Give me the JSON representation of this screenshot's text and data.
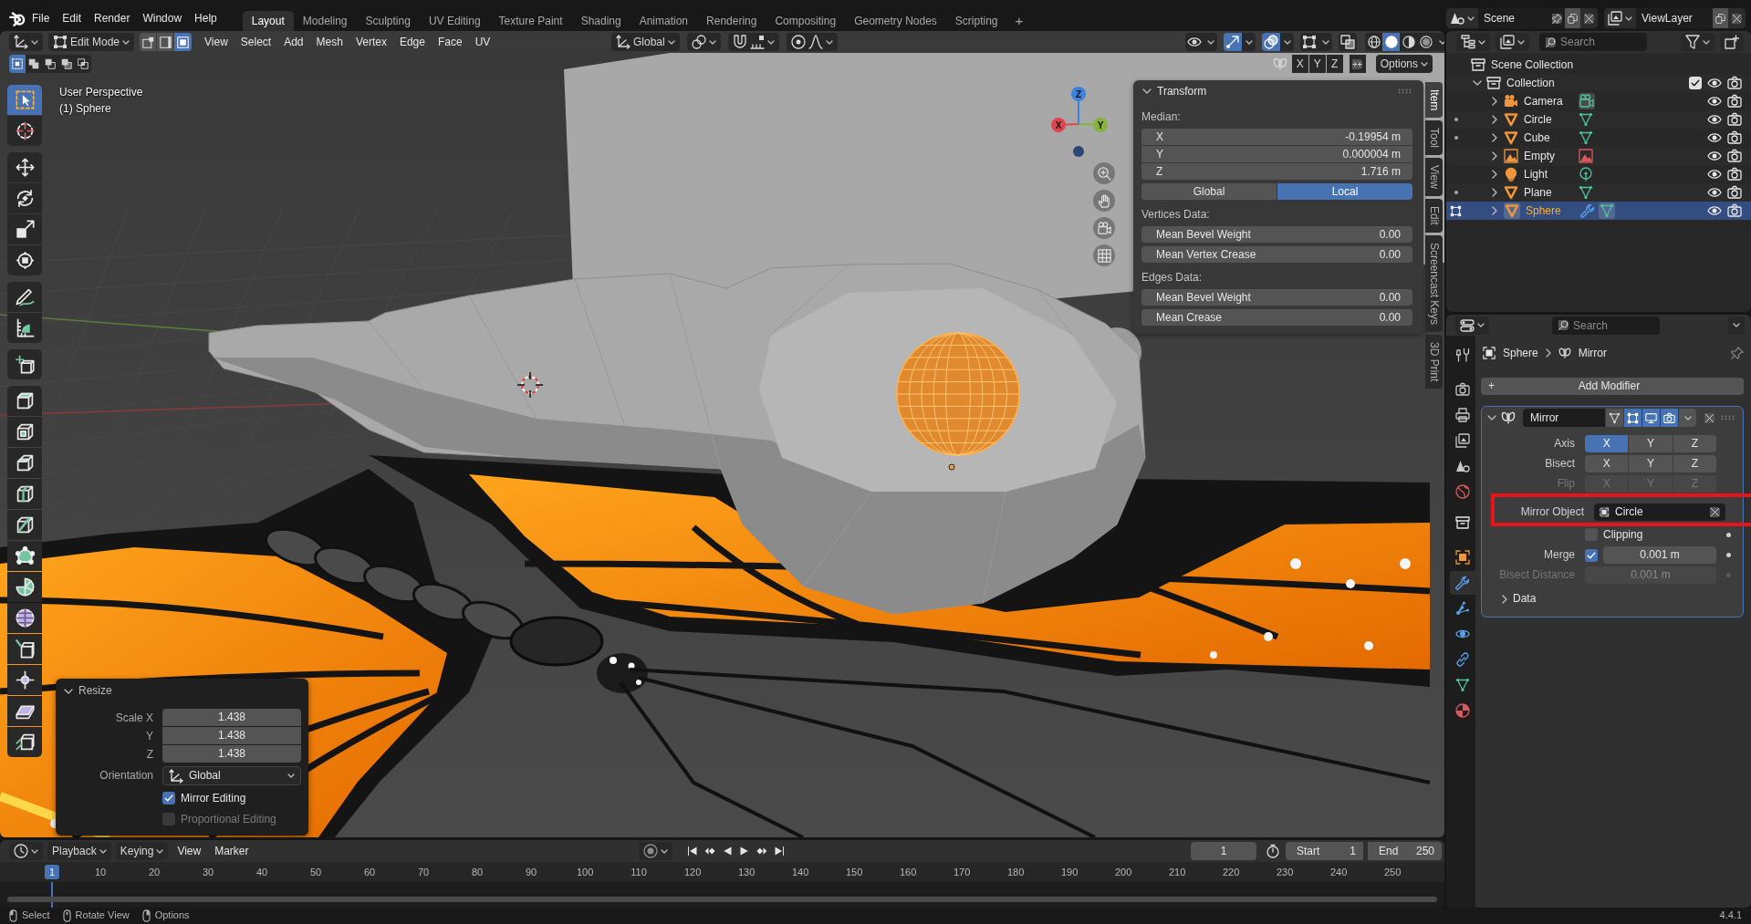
{
  "top_bar": {
    "menus": [
      "File",
      "Edit",
      "Render",
      "Window",
      "Help"
    ],
    "workspaces": [
      {
        "label": "Layout",
        "selected": true
      },
      {
        "label": "Modeling",
        "selected": false
      },
      {
        "label": "Sculpting",
        "selected": false
      },
      {
        "label": "UV Editing",
        "selected": false
      },
      {
        "label": "Texture Paint",
        "selected": false
      },
      {
        "label": "Shading",
        "selected": false
      },
      {
        "label": "Animation",
        "selected": false
      },
      {
        "label": "Rendering",
        "selected": false
      },
      {
        "label": "Compositing",
        "selected": false
      },
      {
        "label": "Geometry Nodes",
        "selected": false
      },
      {
        "label": "Scripting",
        "selected": false
      }
    ],
    "add_workspace": "+",
    "scene": "Scene",
    "view_layer": "ViewLayer"
  },
  "viewport_header": {
    "mode": "Edit Mode",
    "select_modes": [
      {
        "kind": "vertex",
        "selected": false
      },
      {
        "kind": "edge",
        "selected": false
      },
      {
        "kind": "face",
        "selected": true
      }
    ],
    "menus": [
      "View",
      "Select",
      "Add",
      "Mesh",
      "Vertex",
      "Edge",
      "Face",
      "UV"
    ],
    "orientation": "Global",
    "toggles": [
      {
        "kind": "visibility",
        "on": false
      },
      {
        "kind": "gizmo",
        "on": true
      },
      {
        "kind": "overlay",
        "on": true
      },
      {
        "kind": "mesh-overlay",
        "on": false
      },
      {
        "kind": "xray",
        "on": false
      }
    ],
    "shading": [
      {
        "kind": "wireframe",
        "selected": false
      },
      {
        "kind": "solid",
        "selected": true
      },
      {
        "kind": "material",
        "selected": false
      },
      {
        "kind": "rendered",
        "selected": false
      }
    ]
  },
  "tool_settings": {
    "select_modes": [
      {
        "kind": "set",
        "selected": true
      },
      {
        "kind": "extend",
        "selected": false
      },
      {
        "kind": "subtract",
        "selected": false
      },
      {
        "kind": "difference",
        "selected": false
      },
      {
        "kind": "intersect",
        "selected": false
      }
    ],
    "mirror_axes": [
      "X",
      "Y",
      "Z"
    ],
    "options": "Options"
  },
  "toolbar": {
    "groups": [
      [
        {
          "kind": "select-box",
          "selected": true
        },
        {
          "kind": "cursor",
          "selected": false
        }
      ],
      [
        {
          "kind": "move",
          "selected": false
        },
        {
          "kind": "rotate",
          "selected": false
        },
        {
          "kind": "scale",
          "selected": false
        },
        {
          "kind": "transform",
          "selected": false
        }
      ],
      [
        {
          "kind": "annotate",
          "selected": false
        },
        {
          "kind": "measure",
          "selected": false
        }
      ],
      [
        {
          "kind": "add-cube",
          "selected": false
        }
      ],
      [
        {
          "kind": "extrude",
          "selected": false
        },
        {
          "kind": "inset",
          "selected": false
        },
        {
          "kind": "bevel",
          "selected": false
        },
        {
          "kind": "loop-cut",
          "selected": false
        },
        {
          "kind": "knife",
          "selected": false
        },
        {
          "kind": "poly-build",
          "selected": false
        },
        {
          "kind": "spin",
          "selected": false
        },
        {
          "kind": "smooth",
          "selected": false
        },
        {
          "kind": "edge-slide",
          "selected": false
        },
        {
          "kind": "shrink-fatten",
          "selected": false
        },
        {
          "kind": "shear",
          "selected": false
        },
        {
          "kind": "rip",
          "selected": false
        }
      ]
    ]
  },
  "viewport": {
    "view_name": "User Perspective",
    "object_label": "(1) Sphere",
    "gizmo_axes": [
      {
        "label": "X",
        "color": "#e0454f"
      },
      {
        "label": "Y",
        "color": "#84b53a"
      },
      {
        "label": "Z",
        "color": "#3b82e0"
      }
    ]
  },
  "sidebar": {
    "tabs": [
      {
        "label": "Item",
        "selected": true
      },
      {
        "label": "Tool",
        "selected": false
      },
      {
        "label": "View",
        "selected": false
      },
      {
        "label": "Edit",
        "selected": false
      },
      {
        "label": "Screencast Keys",
        "selected": false
      },
      {
        "label": "3D Print",
        "selected": false
      }
    ],
    "panel": {
      "title": "Transform",
      "expanded": true,
      "sections": [
        {
          "heading": "Median:",
          "fields": [
            {
              "label": "X",
              "value": "-0.19954 m"
            },
            {
              "label": "Y",
              "value": "0.000004 m"
            },
            {
              "label": "Z",
              "value": "1.716 m"
            }
          ],
          "space": [
            {
              "label": "Global",
              "selected": false
            },
            {
              "label": "Local",
              "selected": true
            }
          ]
        },
        {
          "heading": "Vertices Data:",
          "fields": [
            {
              "label": "Mean Bevel Weight",
              "value": "0.00"
            },
            {
              "label": "Mean Vertex Crease",
              "value": "0.00"
            }
          ]
        },
        {
          "heading": "Edges Data:",
          "fields": [
            {
              "label": "Mean Bevel Weight",
              "value": "0.00"
            },
            {
              "label": "Mean Crease",
              "value": "0.00"
            }
          ]
        }
      ]
    }
  },
  "operator_panel": {
    "title": "Resize",
    "expanded": true,
    "fields": [
      {
        "label": "Scale X",
        "value": "1.438"
      },
      {
        "label": "Y",
        "value": "1.438"
      },
      {
        "label": "Z",
        "value": "1.438"
      }
    ],
    "orientation": {
      "label": "Orientation",
      "value": "Global"
    },
    "options": [
      {
        "label": "Mirror Editing",
        "checked": true,
        "disabled": false
      },
      {
        "label": "Proportional Editing",
        "checked": false,
        "disabled": true
      }
    ]
  },
  "timeline": {
    "menus": [
      {
        "label": "Playback",
        "dropdown": true
      },
      {
        "label": "Keying",
        "dropdown": true
      },
      {
        "label": "View",
        "dropdown": false
      },
      {
        "label": "Marker",
        "dropdown": false
      }
    ],
    "current_frame": "1",
    "start": {
      "label": "Start",
      "value": "1"
    },
    "end": {
      "label": "End",
      "value": "250"
    },
    "ruler": [
      {
        "label": "1",
        "selected": true
      },
      {
        "label": "10",
        "selected": false
      },
      {
        "label": "20",
        "selected": false
      },
      {
        "label": "30",
        "selected": false
      },
      {
        "label": "40",
        "selected": false
      },
      {
        "label": "50",
        "selected": false
      },
      {
        "label": "60",
        "selected": false
      },
      {
        "label": "70",
        "selected": false
      },
      {
        "label": "80",
        "selected": false
      },
      {
        "label": "90",
        "selected": false
      },
      {
        "label": "100",
        "selected": false
      },
      {
        "label": "110",
        "selected": false
      },
      {
        "label": "120",
        "selected": false
      },
      {
        "label": "130",
        "selected": false
      },
      {
        "label": "140",
        "selected": false
      },
      {
        "label": "150",
        "selected": false
      },
      {
        "label": "160",
        "selected": false
      },
      {
        "label": "170",
        "selected": false
      },
      {
        "label": "180",
        "selected": false
      },
      {
        "label": "190",
        "selected": false
      },
      {
        "label": "200",
        "selected": false
      },
      {
        "label": "210",
        "selected": false
      },
      {
        "label": "220",
        "selected": false
      },
      {
        "label": "230",
        "selected": false
      },
      {
        "label": "240",
        "selected": false
      },
      {
        "label": "250",
        "selected": false
      }
    ]
  },
  "outliner": {
    "search": {
      "placeholder": "Search"
    },
    "tree": [
      {
        "label": "Scene Collection",
        "kind": "scene-collection",
        "children": [
          {
            "label": "Collection",
            "kind": "collection",
            "expanded": true,
            "checked": true,
            "visible": true,
            "renderable": true,
            "children": [
              {
                "label": "Camera",
                "kind": "camera",
                "data": {
                  "kind": "camera",
                  "highlighted": true
                },
                "modifier": false,
                "selected": false,
                "expanded": false,
                "visible": true,
                "renderable": true
              },
              {
                "label": "Circle",
                "kind": "mesh",
                "data": {
                  "kind": "mesh",
                  "highlighted": false
                },
                "mode_marker": {
                  "kind": "dot"
                },
                "modifier": false,
                "selected": false,
                "expanded": false,
                "visible": true,
                "renderable": true
              },
              {
                "label": "Cube",
                "kind": "mesh",
                "data": {
                  "kind": "mesh",
                  "highlighted": false
                },
                "mode_marker": {
                  "kind": "dot"
                },
                "modifier": false,
                "selected": false,
                "expanded": false,
                "visible": true,
                "renderable": true
              },
              {
                "label": "Empty",
                "kind": "empty",
                "data": {
                  "kind": "image",
                  "highlighted": false
                },
                "modifier": false,
                "selected": false,
                "expanded": false,
                "visible": true,
                "renderable": true
              },
              {
                "label": "Light",
                "kind": "light",
                "data": {
                  "kind": "light",
                  "highlighted": false
                },
                "modifier": false,
                "selected": false,
                "expanded": false,
                "visible": true,
                "renderable": true
              },
              {
                "label": "Plane",
                "kind": "mesh",
                "data": {
                  "kind": "mesh",
                  "highlighted": false
                },
                "mode_marker": {
                  "kind": "dot"
                },
                "modifier": false,
                "selected": false,
                "expanded": false,
                "visible": true,
                "renderable": true
              },
              {
                "label": "Sphere",
                "kind": "mesh",
                "data": {
                  "kind": "mesh",
                  "highlighted": true
                },
                "mode_marker": {
                  "kind": "edit"
                },
                "modifier": true,
                "selected": true,
                "expanded": false,
                "visible": true,
                "renderable": true
              }
            ]
          }
        ]
      }
    ]
  },
  "properties": {
    "search": {
      "placeholder": "Search"
    },
    "tabs": [
      {
        "kind": "tool",
        "selected": false
      },
      {
        "kind": "render",
        "selected": false
      },
      {
        "kind": "output",
        "selected": false
      },
      {
        "kind": "view-layer",
        "selected": false
      },
      {
        "kind": "scene",
        "selected": false
      },
      {
        "kind": "world",
        "selected": false
      },
      {
        "kind": "collection",
        "selected": false
      },
      {
        "kind": "object",
        "selected": false
      },
      {
        "kind": "modifiers",
        "selected": true
      },
      {
        "kind": "particles",
        "selected": false
      },
      {
        "kind": "physics",
        "selected": false
      },
      {
        "kind": "constraints",
        "selected": false
      },
      {
        "kind": "data",
        "selected": false
      },
      {
        "kind": "material",
        "selected": false
      }
    ],
    "breadcrumb": [
      {
        "kind": "object",
        "label": "Sphere"
      },
      {
        "kind": "modifier",
        "label": "Mirror"
      }
    ],
    "add_modifier": {
      "icon": "+",
      "label": "Add Modifier"
    },
    "modifier": {
      "name": "Mirror",
      "active": true,
      "expanded": true,
      "toggles": [
        {
          "kind": "cage",
          "on": false
        },
        {
          "kind": "edit-mode",
          "on": true
        },
        {
          "kind": "viewport",
          "on": true
        },
        {
          "kind": "render",
          "on": true
        }
      ],
      "rows": [
        {
          "kind": "axes",
          "label": "Axis",
          "disabled": false,
          "options": [
            {
              "label": "X",
              "selected": true
            },
            {
              "label": "Y",
              "selected": false
            },
            {
              "label": "Z",
              "selected": false
            }
          ]
        },
        {
          "kind": "axes",
          "label": "Bisect",
          "disabled": false,
          "options": [
            {
              "label": "X",
              "selected": false
            },
            {
              "label": "Y",
              "selected": false
            },
            {
              "label": "Z",
              "selected": false
            }
          ]
        },
        {
          "kind": "axes",
          "label": "Flip",
          "disabled": true,
          "options": [
            {
              "label": "X",
              "selected": false
            },
            {
              "label": "Y",
              "selected": false
            },
            {
              "label": "Z",
              "selected": false
            }
          ]
        },
        {
          "kind": "object",
          "label": "Mirror Object",
          "value": "Circle",
          "highlighted": true
        },
        {
          "kind": "checkbox",
          "label": "Clipping",
          "checked": false
        },
        {
          "kind": "checkbox-value",
          "label": "Merge",
          "checked": true,
          "value": "0.001 m"
        },
        {
          "kind": "value",
          "label": "Bisect Distance",
          "value": "0.001 m",
          "disabled": true
        }
      ],
      "subpanels": [
        {
          "label": "Data",
          "expanded": false
        }
      ]
    }
  },
  "status_bar": {
    "hints": [
      {
        "kind": "left",
        "label": "Select"
      },
      {
        "kind": "middle",
        "label": "Rotate View"
      },
      {
        "kind": "right",
        "label": "Options"
      }
    ],
    "version": "4.4.1"
  }
}
